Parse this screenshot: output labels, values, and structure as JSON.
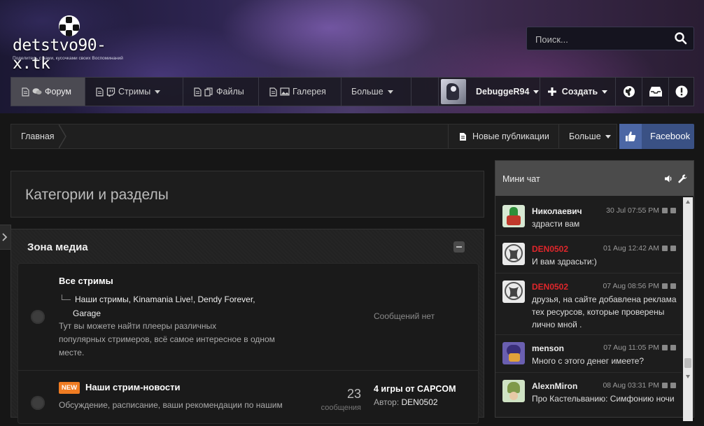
{
  "site": {
    "name": "detstvo90-x.tk",
    "tagline": "Поделитесь с нами, кусочками своих Воспоминаний"
  },
  "search": {
    "placeholder": "Поиск..."
  },
  "nav": {
    "items": [
      {
        "label": "Форум"
      },
      {
        "label": "Стримы"
      },
      {
        "label": "Файлы"
      },
      {
        "label": "Галерея"
      },
      {
        "label": "Больше"
      }
    ],
    "user": "DebuggeR94",
    "create": "Создать"
  },
  "breadcrumb": {
    "home": "Главная",
    "new_posts": "Новые публикации",
    "more": "Больше",
    "facebook": "Facebook"
  },
  "page_title": "Категории и разделы",
  "category": {
    "title": "Зона медиа",
    "forums": [
      {
        "name": "Все стримы",
        "subforums_line1": "Наши стримы,   Kinamania Live!,   Dendy Forever,",
        "subforums_line2": "Garage",
        "desc_line1": "Тут вы можете найти плееры различных",
        "desc_line2": "популярных стримеров, всё самое интересное в одном",
        "desc_line3": "месте.",
        "last": "Сообщений нет"
      },
      {
        "badge": "NEW",
        "name": "Наши стрим-новости",
        "desc_line1": "Обсуждение, расписание, ваши рекомендации по нашим",
        "count": "23",
        "count_label": "сообщения",
        "last_title": "4 игры от CAPCOM",
        "last_author_prefix": "Автор:",
        "last_author": "DEN0502"
      }
    ]
  },
  "chat": {
    "title": "Мини чат",
    "colors": {
      "normal": "#eeeeee",
      "highlight": "#e0262b"
    },
    "messages": [
      {
        "user": "Николаевич",
        "time": "30 Jul 07:55 PM",
        "text1": "здрасти вам",
        "color": "normal"
      },
      {
        "user": "DEN0502",
        "time": "01 Aug 12:42 AM",
        "text1": "И вам здрасьти:)",
        "color": "highlight"
      },
      {
        "user": "DEN0502",
        "time": "07 Aug 08:56 PM",
        "text1": "друзья, на сайте добавлена реклама",
        "text2": "тех ресурсов, которые проверены",
        "text3": "лично мной .",
        "color": "highlight"
      },
      {
        "user": "menson",
        "time": "07 Aug 11:05 PM",
        "text1": "Много с этого денег имеете?",
        "color": "normal"
      },
      {
        "user": "AlexnMiron",
        "time": "08 Aug 03:31 PM",
        "text1": "Про Кастельванию: Симфонию ночи",
        "color": "normal"
      }
    ]
  }
}
